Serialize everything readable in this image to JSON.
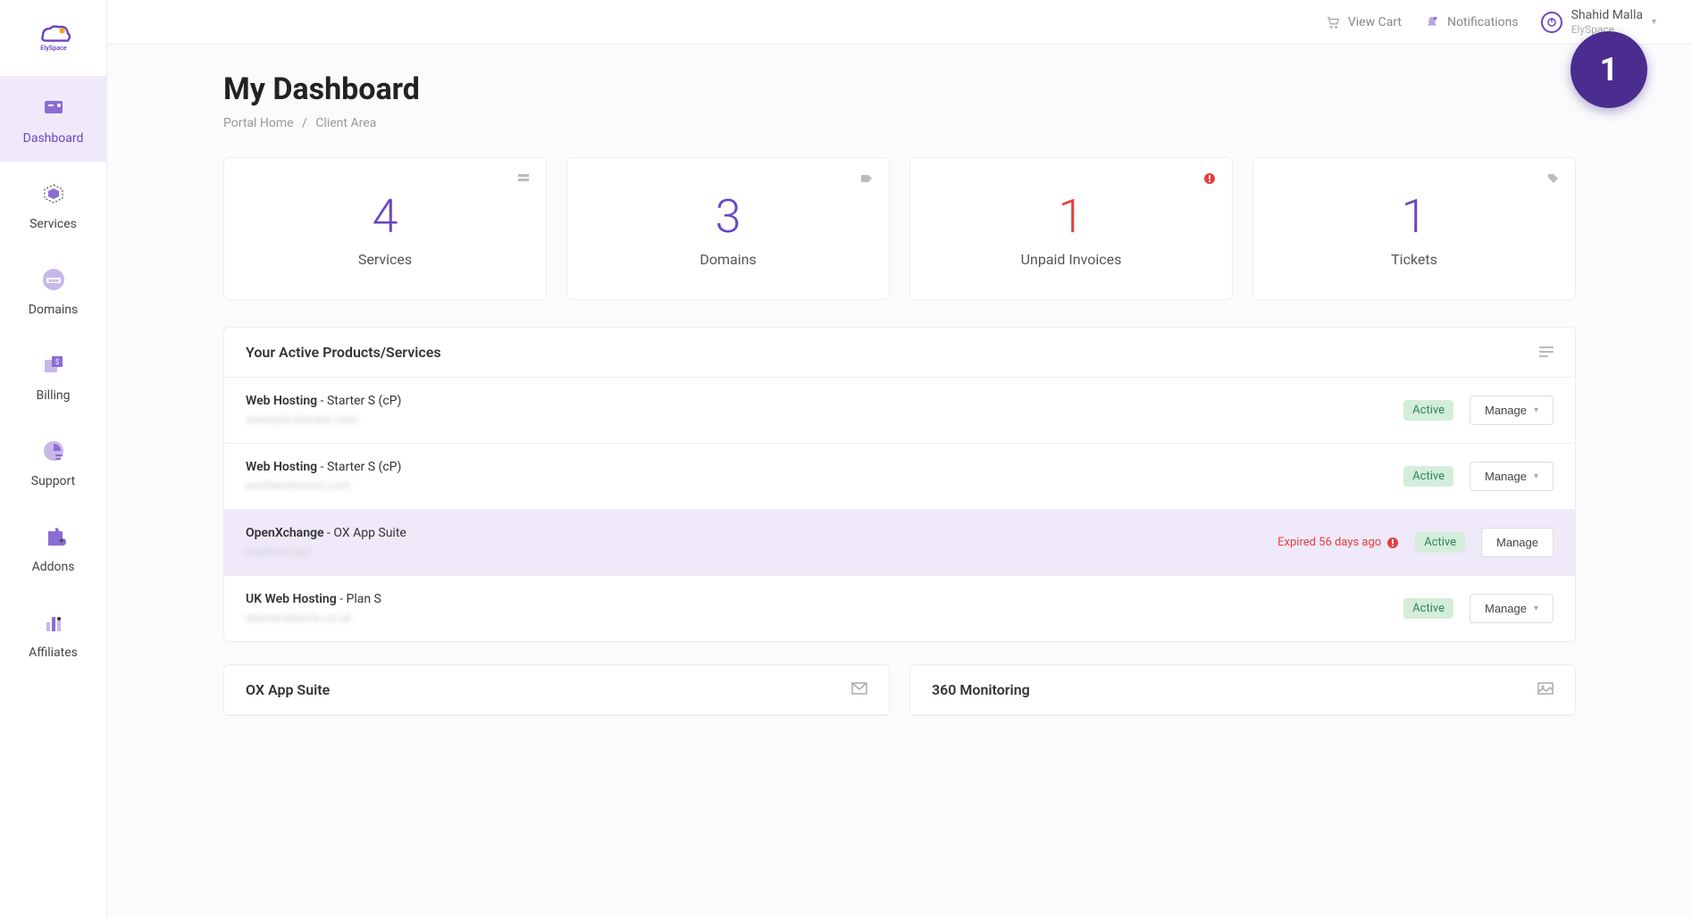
{
  "brand": "ElySpace",
  "topbar": {
    "cart": "View Cart",
    "notifications": "Notifications",
    "user_name": "Shahid Malla",
    "user_sub": "ElySpace"
  },
  "sidebar": {
    "items": [
      {
        "label": "Dashboard"
      },
      {
        "label": "Services"
      },
      {
        "label": "Domains"
      },
      {
        "label": "Billing"
      },
      {
        "label": "Support"
      },
      {
        "label": "Addons"
      },
      {
        "label": "Affiliates"
      }
    ]
  },
  "page": {
    "title": "My Dashboard",
    "breadcrumb_home": "Portal Home",
    "breadcrumb_current": "Client Area"
  },
  "stats": [
    {
      "value": "4",
      "label": "Services"
    },
    {
      "value": "3",
      "label": "Domains"
    },
    {
      "value": "1",
      "label": "Unpaid Invoices"
    },
    {
      "value": "1",
      "label": "Tickets"
    }
  ],
  "services_panel": {
    "title": "Your Active Products/Services",
    "active_badge": "Active",
    "manage_label": "Manage",
    "rows": [
      {
        "category": "Web Hosting",
        "plan": " - Starter S (cP)",
        "sub": "example-domain.com",
        "expired": ""
      },
      {
        "category": "Web Hosting",
        "plan": " - Starter S (cP)",
        "sub": "anotherdomain.com",
        "expired": ""
      },
      {
        "category": "OpenXchange",
        "plan": " - OX App Suite",
        "sub": "mailhost.xyz",
        "expired": "Expired 56 days ago"
      },
      {
        "category": "UK Web Hosting",
        "plan": " - Plan S",
        "sub": "ukexamplesite.co.uk",
        "expired": ""
      }
    ]
  },
  "bottom_panels": {
    "left": "OX App Suite",
    "right": "360 Monitoring"
  },
  "fab": "1"
}
